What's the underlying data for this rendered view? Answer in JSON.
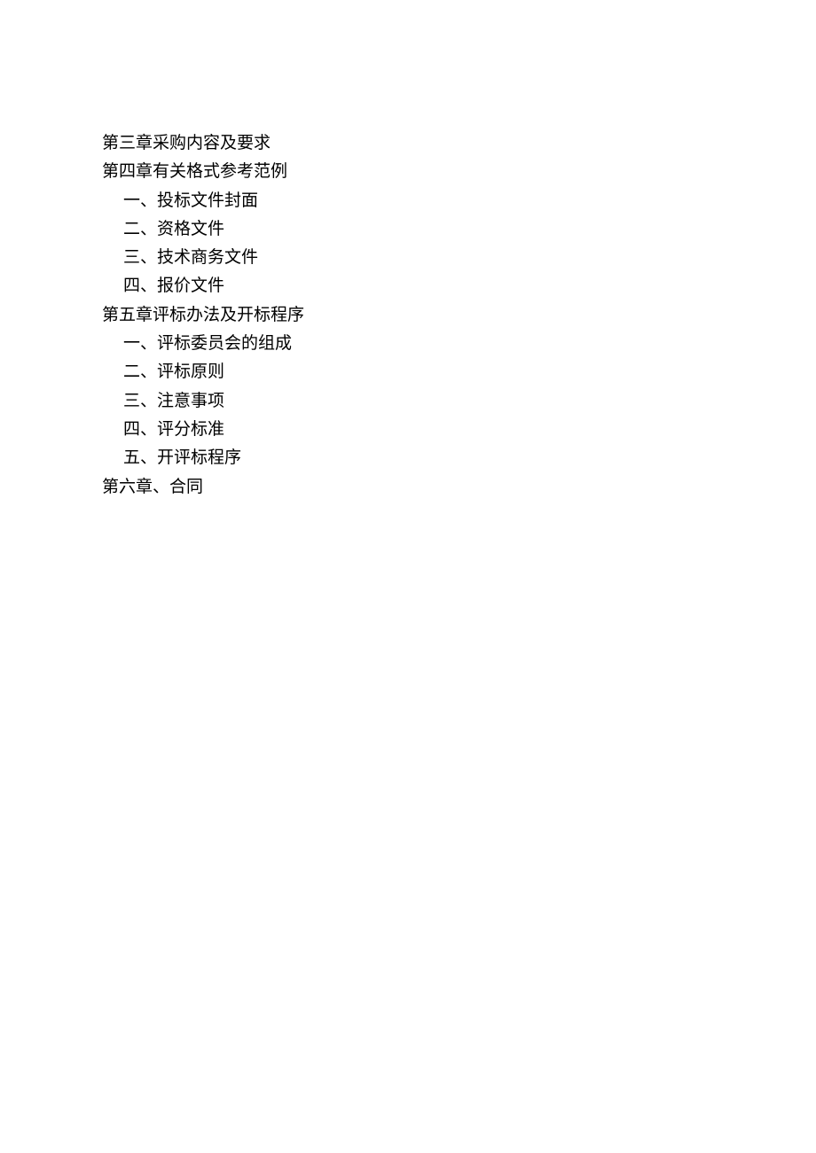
{
  "toc": {
    "chapter3": "第三章采购内容及要求",
    "chapter4": "第四章有关格式参考范例",
    "chapter4_items": {
      "item1": "一、投标文件封面",
      "item2": "二、资格文件",
      "item3": "三、技术商务文件",
      "item4": "四、报价文件"
    },
    "chapter5": "第五章评标办法及开标程序",
    "chapter5_items": {
      "item1": "一、评标委员会的组成",
      "item2": "二、评标原则",
      "item3": "三、注意事项",
      "item4": "四、评分标准",
      "item5": "五、开评标程序"
    },
    "chapter6": "第六章、合同"
  }
}
